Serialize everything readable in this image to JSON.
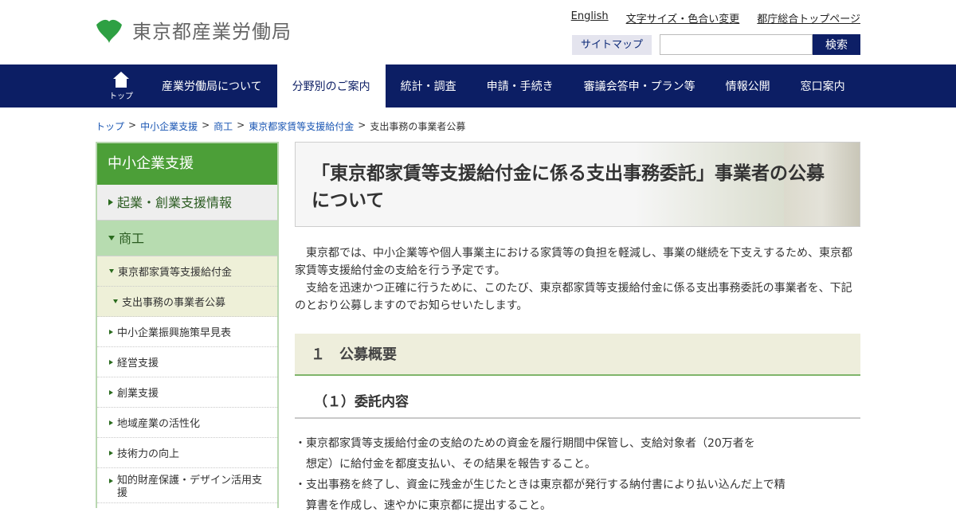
{
  "header": {
    "logo_text": "東京都産業労働局",
    "util_links": [
      "English",
      "文字サイズ・色合い変更",
      "都庁総合トップページ"
    ],
    "sitemap_label": "サイトマップ",
    "search_placeholder": "",
    "search_button": "検索",
    "brand_color": "#4c9f38"
  },
  "nav": {
    "home_label": "トップ",
    "items": [
      "産業労働局について",
      "分野別のご案内",
      "統計・調査",
      "申請・手続き",
      "審議会答申・プラン等",
      "情報公開",
      "窓口案内"
    ],
    "active_index": 1
  },
  "breadcrumb": {
    "links": [
      "トップ",
      "中小企業支援",
      "商工",
      "東京都家賃等支援給付金"
    ],
    "current": "支出事務の事業者公募",
    "separator": ">"
  },
  "sidebar": {
    "heading": "中小企業支援",
    "sections": [
      {
        "label": "起業・創業支援情報"
      },
      {
        "label": "商工"
      }
    ],
    "items": [
      "東京都家賃等支援給付金",
      "支出事務の事業者公募",
      "中小企業振興施策早見表",
      "経営支援",
      "創業支援",
      "地域産業の活性化",
      "技術力の向上",
      "知的財産保護・デザイン活用支援"
    ]
  },
  "main": {
    "title": "「東京都家賃等支援給付金に係る支出事務委託」事業者の公募について",
    "intro": [
      "東京都では、中小企業等や個人事業主における家賃等の負担を軽減し、事業の継続を下支えするため、東京都家賃等支援給付金の支給を行う予定です。",
      "支給を迅速かつ正確に行うために、このたび、東京都家賃等支援給付金に係る支出事務委託の事業者を、下記のとおり公募しますのでお知らせいたします。"
    ],
    "section_title": "１　公募概要",
    "subsection_title": "（１）委託内容",
    "bullets": [
      {
        "first": "・東京都家賃等支援給付金の支給のための資金を履行期間中保管し、支給対象者（20万者を",
        "cont": "想定）に給付金を都度支払い、その結果を報告すること。"
      },
      {
        "first": "・支出事務を終了し、資金に残金が生じたときは東京都が発行する納付書により払い込んだ上で精",
        "cont": "算書を作成し、速やかに東京都に提出すること。"
      }
    ]
  }
}
